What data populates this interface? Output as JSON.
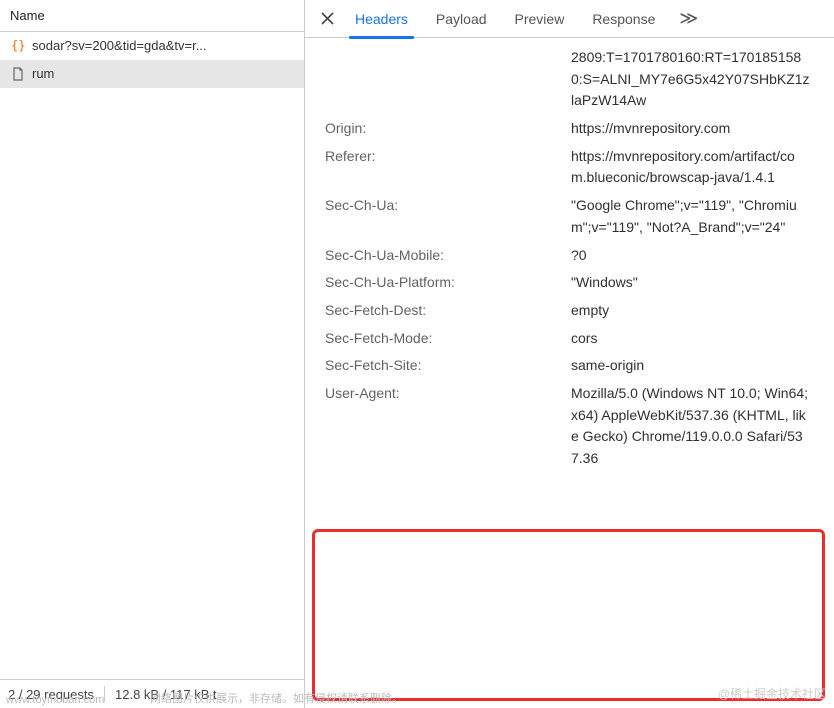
{
  "left": {
    "header": "Name",
    "items": [
      {
        "label": "sodar?sv=200&tid=gda&tv=r...",
        "icon": "braces",
        "selected": false
      },
      {
        "label": "rum",
        "icon": "file",
        "selected": true
      }
    ],
    "status": {
      "requests": "2 / 29 requests",
      "transfer": "12.8 kB / 117 kB t"
    }
  },
  "tabs": {
    "items": [
      "Headers",
      "Payload",
      "Preview",
      "Response"
    ],
    "active": 0,
    "more": "≫"
  },
  "headers": [
    {
      "k": "",
      "v": "2809:T=1701780160:RT=1701851580:S=ALNI_MY7e6G5x42Y07SHbKZ1zlaPzW14Aw"
    },
    {
      "k": "Origin:",
      "v": "https://mvnrepository.com"
    },
    {
      "k": "Referer:",
      "v": "https://mvnrepository.com/artifact/com.blueconic/browscap-java/1.4.1"
    },
    {
      "k": "Sec-Ch-Ua:",
      "v": "\"Google Chrome\";v=\"119\", \"Chromium\";v=\"119\", \"Not?A_Brand\";v=\"24\""
    },
    {
      "k": "Sec-Ch-Ua-Mobile:",
      "v": "?0"
    },
    {
      "k": "Sec-Ch-Ua-Platform:",
      "v": "\"Windows\""
    },
    {
      "k": "Sec-Fetch-Dest:",
      "v": "empty"
    },
    {
      "k": "Sec-Fetch-Mode:",
      "v": "cors"
    },
    {
      "k": "Sec-Fetch-Site:",
      "v": "same-origin"
    },
    {
      "k": "User-Agent:",
      "v": "Mozilla/5.0 (Windows NT 10.0; Win64; x64) AppleWebKit/537.36 (KHTML, like Gecko) Chrome/119.0.0.0 Safari/537.36"
    }
  ],
  "watermarks": {
    "left": "www.toymoban.com",
    "center": "网络图片仅供展示，非存储。如有侵权请联系删除。",
    "right": "@稀土掘金技术社区"
  }
}
